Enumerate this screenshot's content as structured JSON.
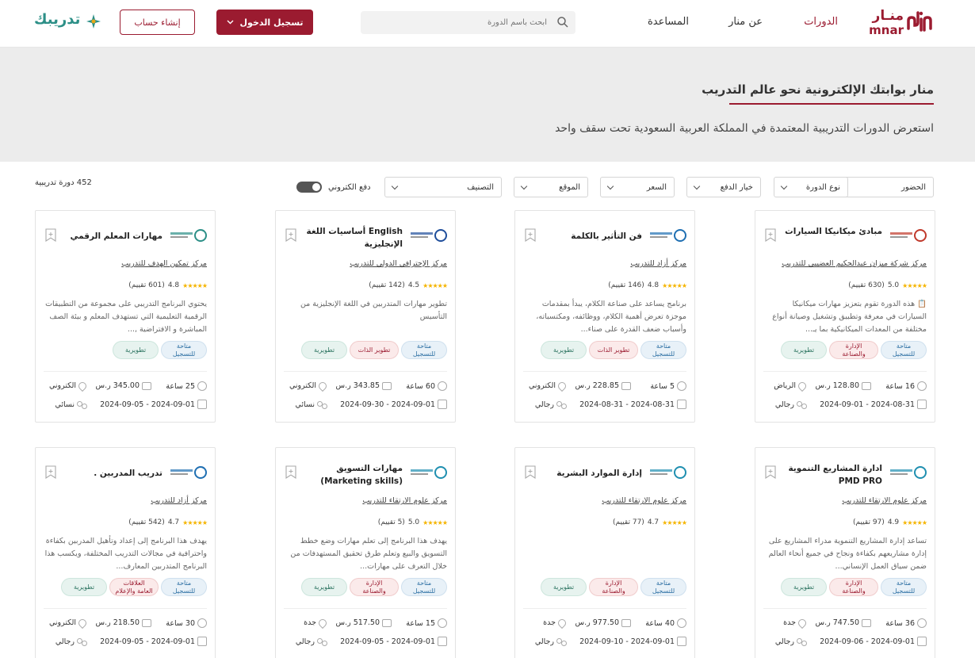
{
  "header": {
    "logo_ar": "منـار",
    "logo_en": "mnar",
    "nav": {
      "courses": "الدورات",
      "about": "عن منار",
      "help": "المساعدة"
    },
    "search_placeholder": "ابحث باسم الدورة",
    "login": "تسجيل الدخول",
    "signup": "إنشاء حساب",
    "partner_logo": "تدريبك"
  },
  "hero": {
    "title": "منار بوابتك الإلكترونية نحو عالم التدريب",
    "subtitle": "استعرض الدورات التدريبية المعتمدة في المملكة العربية السعودية تحت سقف واحد"
  },
  "filters": {
    "attendance": "الحضور",
    "course_type": "نوع الدورة",
    "payment_option": "خيار الدفع",
    "price": "السعر",
    "location": "الموقع",
    "category": "التصنيف",
    "e_payment": "دفع الكتروني",
    "count": "452 دورة تدريبية"
  },
  "courses": [
    {
      "title": "مبادئ ميكانيكا السيارات",
      "provider": "مركز شركة ميزان عبدالحكيم العضيبي للتدريب",
      "rating": "5.0",
      "reviews": "(630 تقييم)",
      "desc": "📋 هذه الدورة تقوم بتعزيز مهارات ميكانيكا السيارات في معرفة وتطبيق وتشغيل وصيانة أنواع مختلفة من المعدات الميكانيكية بما يـ...",
      "tags": [
        "متاحة للتسجيل",
        "الإدارة والصناعة",
        "تطويرية"
      ],
      "hours": "16 ساعة",
      "price": "128.80 ر.س",
      "location": "الرياض",
      "dates": "2024-08-31 - 2024-09-01",
      "gender": "رجالي"
    },
    {
      "title": "فن التأثير بالكلمة",
      "provider": "مركز أزاد للتدريب",
      "rating": "4.8",
      "reviews": "(146 تقييم)",
      "desc": "برنامج يساعد على صناعة الكلام، يبدأ بمقدمات موجزة تعرض أهمية الكلام، ووظائفه، ومكتسباته، وأسباب ضعف القدرة على صناء...",
      "tags": [
        "متاحة للتسجيل",
        "تطوير الذات",
        "تطويرية"
      ],
      "hours": "5 ساعة",
      "price": "228.85 ر.س",
      "location": "الكتروني",
      "dates": "2024-08-31 - 2024-08-31",
      "gender": "رجالي"
    },
    {
      "title": "English أساسيات اللغة الإنجليزية",
      "provider": "مركز الإحترافي الدولي للتدريب",
      "rating": "4.5",
      "reviews": "(142 تقييم)",
      "desc": "تطوير مهارات المتدربين في اللغة الإنجليزية من التأسيس",
      "tags": [
        "متاحة للتسجيل",
        "تطوير الذات",
        "تطويرية"
      ],
      "hours": "60 ساعة",
      "price": "343.85 ر.س",
      "location": "الكتروني",
      "dates": "2024-09-01 - 2024-09-30",
      "gender": "نسائي"
    },
    {
      "title": "مهارات المعلم الرقمي",
      "provider": "مركز تمكين الهدف للتدريب",
      "rating": "4.8",
      "reviews": "(601 تقييم)",
      "desc": "يحتوي البرنامج التدريبي على مجموعة من التطبيقات الرقمية التعليمية التي تستهدف المعلم و بيئة الصف المباشرة و الافتراضية ,...",
      "tags": [
        "متاحة للتسجيل",
        "تطويرية"
      ],
      "hours": "25 ساعة",
      "price": "345.00 ر.س",
      "location": "الكتروني",
      "dates": "2024-09-01 - 2024-09-05",
      "gender": "نسائي"
    },
    {
      "title": "ادارة المشاريع التنموية PMD PRO",
      "provider": "مركز علوم الارتقاء للتدريب",
      "rating": "4.9",
      "reviews": "(97 تقييم)",
      "desc": "تساعد إدارة المشاريع التنموية مدراء المشاريع على إدارة مشاريعهم بكفاءة ونجاح في جميع أنحاء العالم ضمن سياق العمل الإنساني...",
      "tags": [
        "متاحة للتسجيل",
        "الإدارة والصناعة",
        "تطويرية"
      ],
      "hours": "36 ساعة",
      "price": "747.50 ر.س",
      "location": "جدة",
      "dates": "2024-09-01 - 2024-09-06",
      "gender": "رجالي"
    },
    {
      "title": "إدارة الموارد البشرية",
      "provider": "مركز علوم الارتقاء للتدريب",
      "rating": "4.7",
      "reviews": "(77 تقييم)",
      "desc": "",
      "tags": [
        "متاحة للتسجيل",
        "الإدارة والصناعة",
        "تطويرية"
      ],
      "hours": "40 ساعة",
      "price": "977.50 ر.س",
      "location": "جدة",
      "dates": "2024-09-01 - 2024-09-10",
      "gender": "رجالي"
    },
    {
      "title": "مهارات التسويق (Marketing skills)",
      "provider": "مركز علوم الارتقاء للتدريب",
      "rating": "5.0",
      "reviews": "(5 تقييم)",
      "desc": "يهدف هذا البرنامج إلى تعلم مهارات وضع خطط التسويق والبيع وتعلم طرق تحقيق المستهدفات من خلال التعرف على مهارات...",
      "tags": [
        "متاحة للتسجيل",
        "الإدارة والصناعة",
        "تطويرية"
      ],
      "hours": "15 ساعة",
      "price": "517.50 ر.س",
      "location": "جدة",
      "dates": "2024-09-01 - 2024-09-05",
      "gender": "رجالي"
    },
    {
      "title": "تدريب المدربين .",
      "provider": "مركز أزاد للتدريب",
      "rating": "4.7",
      "reviews": "(542 تقييم)",
      "desc": "يهدف هذا البرنامج إلى إعداد وتأهيل المدربين بكفاءة واحترافية في مجالات التدريب المختلفة، ويكسب هذا البرنامج المتدربين المعارف...",
      "tags": [
        "متاحة للتسجيل",
        "العلاقات العامة والإعلام",
        "تطويرية"
      ],
      "hours": "30 ساعة",
      "price": "218.50 ر.س",
      "location": "الكتروني",
      "dates": "2024-09-01 - 2024-09-05",
      "gender": "رجالي"
    }
  ],
  "colors": {
    "brand": "#9b1b30",
    "hero_bg": "#ececec",
    "star": "#f5b400"
  }
}
